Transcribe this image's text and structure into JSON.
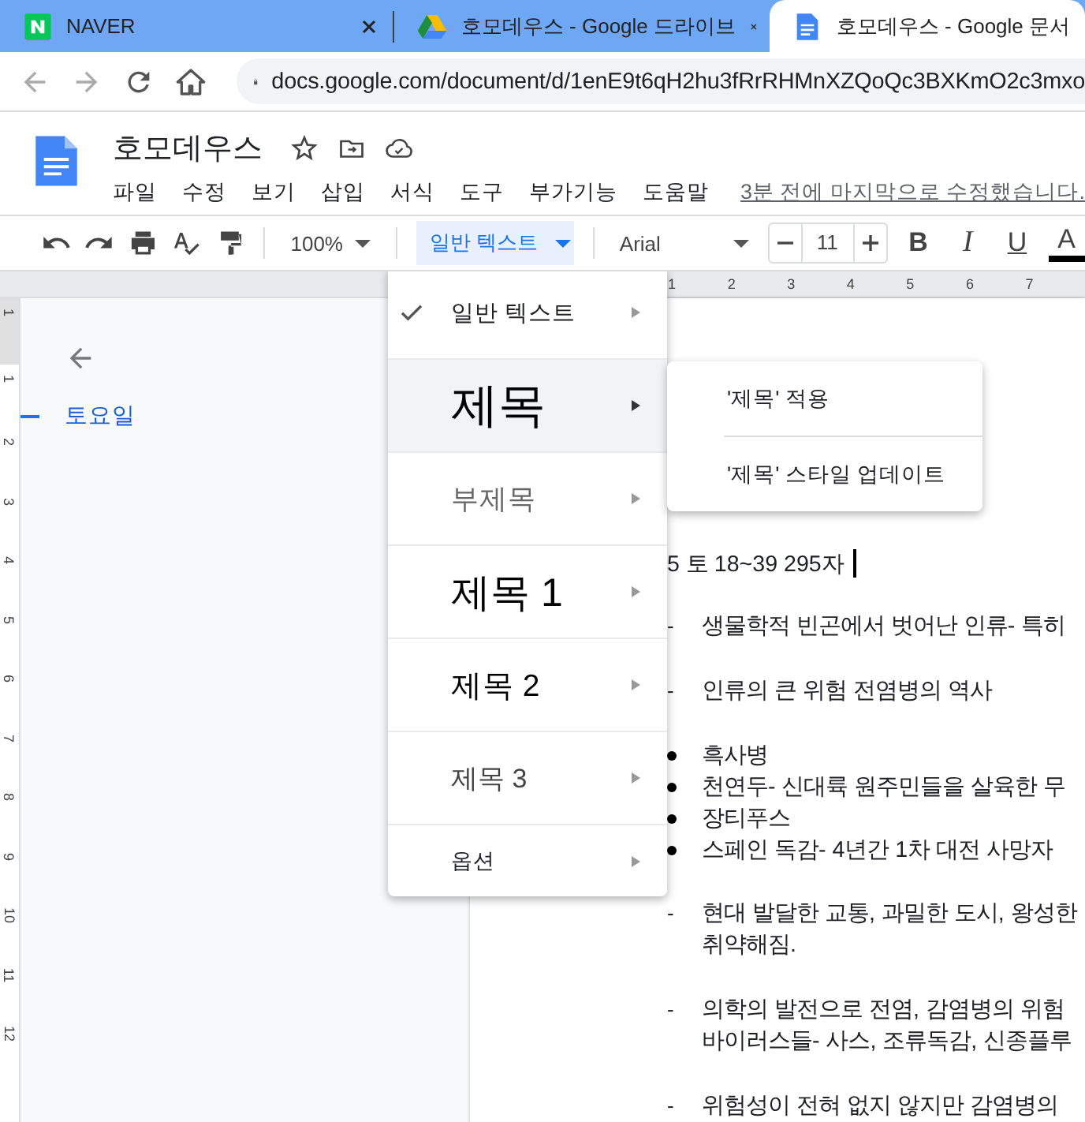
{
  "browser_tabs": [
    {
      "title": "NAVER",
      "kind": "naver",
      "selected": false
    },
    {
      "title": "호모데우스 - Google 드라이브",
      "kind": "drive",
      "selected": false
    },
    {
      "title": "호모데우스 - Google 문서",
      "kind": "docs",
      "selected": true
    }
  ],
  "address_bar": {
    "url": "docs.google.com/document/d/1enE9t6qH2hu3fRrRHMnXZQoQc3BXKmO2c3mxo"
  },
  "document": {
    "title": "호모데우스",
    "last_edit": "3분 전에 마지막으로 수정했습니다."
  },
  "menu_bar": [
    "파일",
    "수정",
    "보기",
    "삽입",
    "서식",
    "도구",
    "부가기능",
    "도움말"
  ],
  "toolbar": {
    "zoom": "100%",
    "style": "일반 텍스트",
    "font": "Arial",
    "font_size": "11",
    "format_buttons": [
      "B",
      "I",
      "U",
      "A"
    ]
  },
  "ruler": {
    "horizontal_ticks": [
      "1",
      "2",
      "3",
      "4",
      "5",
      "6",
      "7"
    ],
    "vertical_ticks": [
      "1",
      "1",
      "2",
      "3",
      "4",
      "5",
      "6",
      "7",
      "8",
      "9",
      "10",
      "11",
      "12"
    ]
  },
  "outline": {
    "items": [
      {
        "label": "토요일",
        "selected": true
      }
    ]
  },
  "style_menu": {
    "items": [
      {
        "label": "일반 텍스트",
        "kind": "normal",
        "checked": true,
        "selected": false
      },
      {
        "label": "제목",
        "kind": "title",
        "checked": false,
        "selected": true
      },
      {
        "label": "부제목",
        "kind": "subtitle",
        "checked": false,
        "selected": false
      },
      {
        "label": "제목 1",
        "kind": "h1",
        "checked": false,
        "selected": false
      },
      {
        "label": "제목 2",
        "kind": "h2",
        "checked": false,
        "selected": false
      },
      {
        "label": "제목 3",
        "kind": "h3",
        "checked": false,
        "selected": false
      },
      {
        "label": "옵션",
        "kind": "options",
        "checked": false,
        "selected": false
      }
    ]
  },
  "style_submenu": {
    "items": [
      "'제목' 적용",
      "'제목' 스타일 업데이트"
    ]
  },
  "body": {
    "heading": "5 토 18~39 295자",
    "blocks": [
      {
        "kind": "dash",
        "marker": "-",
        "lines": [
          "생물학적 빈곤에서 벗어난 인류- 특히"
        ]
      },
      {
        "kind": "dash",
        "marker": "-",
        "lines": [
          "인류의 큰 위험 전염병의 역사"
        ]
      },
      {
        "kind": "bullet",
        "lines": [
          "흑사병"
        ]
      },
      {
        "kind": "bullet",
        "lines": [
          "천연두- 신대륙 원주민들을 살육한 무"
        ]
      },
      {
        "kind": "bullet",
        "lines": [
          "장티푸스"
        ]
      },
      {
        "kind": "bullet",
        "lines": [
          "스페인 독감- 4년간 1차 대전 사망자"
        ]
      },
      {
        "kind": "dash",
        "marker": "-",
        "lines": [
          "현대 발달한 교통, 과밀한 도시, 왕성한",
          "취약해짐."
        ]
      },
      {
        "kind": "dash",
        "marker": "-",
        "lines": [
          "의학의 발전으로 전염, 감염병의 위험",
          "바이러스들- 사스, 조류독감, 신종플루"
        ]
      },
      {
        "kind": "dash",
        "marker": "-",
        "lines": [
          "위험성이 전혀 없지 않지만 감염병의"
        ]
      }
    ]
  }
}
